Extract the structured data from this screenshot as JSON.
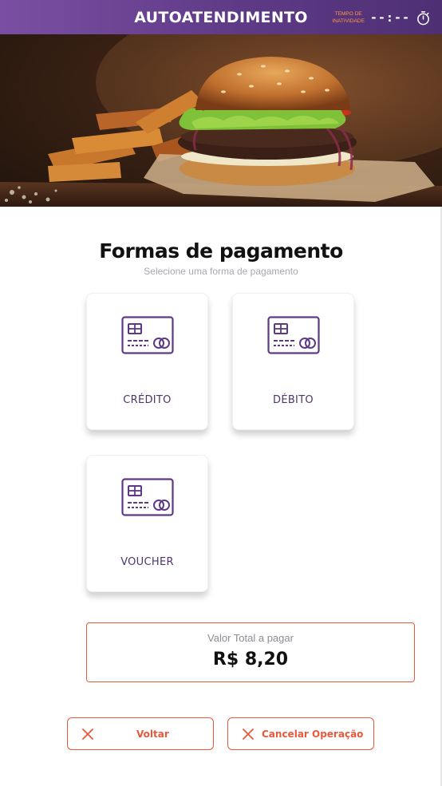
{
  "header": {
    "title": "AUTOATENDIMENTO",
    "inactivity_label_line1": "TEMPO DE",
    "inactivity_label_line2": "INATIVIDADE",
    "inactivity_value": "--:--",
    "timer_icon": "stopwatch-icon"
  },
  "hero": {
    "image": "burger-and-fries-photo"
  },
  "main": {
    "title": "Formas de pagamento",
    "subtitle": "Selecione uma forma de pagamento",
    "payment_methods": [
      {
        "label": "CRÉDITO",
        "icon": "credit-card-icon"
      },
      {
        "label": "DÉBITO",
        "icon": "credit-card-icon"
      },
      {
        "label": "VOUCHER",
        "icon": "credit-card-icon"
      }
    ]
  },
  "total": {
    "label": "Valor Total a pagar",
    "value": "R$ 8,20"
  },
  "actions": {
    "back_label": "Voltar",
    "cancel_label": "Cancelar Operação",
    "icon": "close-x-icon"
  },
  "colors": {
    "header_purple": "#5e3a86",
    "accent_orange": "#e8583a",
    "card_text_purple": "#4e3370",
    "timer_label_orange": "#ff9a3c"
  }
}
